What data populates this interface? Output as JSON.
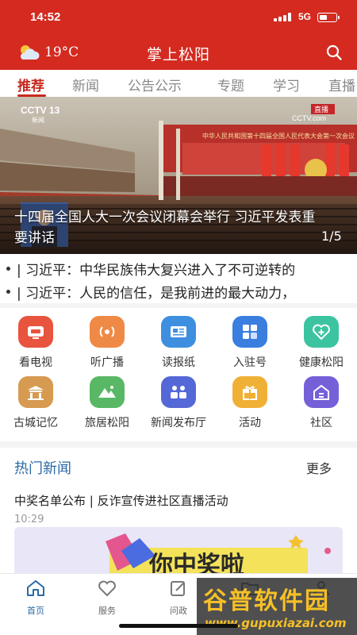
{
  "status": {
    "time": "14:52",
    "network": "5G"
  },
  "header": {
    "temperature": "19°C",
    "title": "掌上松阳",
    "weather_icon": "partly-cloudy-icon",
    "search_icon": "search-icon"
  },
  "tabs": [
    {
      "label": "推荐",
      "active": true
    },
    {
      "label": "新闻"
    },
    {
      "label": "公告公示"
    },
    {
      "label": "专题"
    },
    {
      "label": "学习"
    },
    {
      "label": "直播"
    }
  ],
  "banner": {
    "caption": "十四届全国人大一次会议闭幕会举行 习近平发表重要讲话",
    "counter": "1/5",
    "logo_text": "CCTV 13",
    "logo_sub": "新闻",
    "corner_badge": "直播",
    "corner_text": "CCTV.com",
    "stage_banner": "中华人民共和国第十四届全国人民代表大会第一次会议"
  },
  "ticker": [
    "| 习近平：中华民族伟大复兴进入了不可逆转的",
    "| 习近平：人民的信任，是我前进的最大动力，"
  ],
  "grid": [
    {
      "label": "看电视",
      "icon": "tv-icon",
      "color": "#e8543e"
    },
    {
      "label": "听广播",
      "icon": "radio-icon",
      "color": "#ef8a46"
    },
    {
      "label": "读报纸",
      "icon": "newspaper-icon",
      "color": "#3e8fe0"
    },
    {
      "label": "入驻号",
      "icon": "grid-apps-icon",
      "color": "#3a7ee0"
    },
    {
      "label": "健康松阳",
      "icon": "health-icon",
      "color": "#3cc4a0"
    },
    {
      "label": "古城记忆",
      "icon": "ancient-city-icon",
      "color": "#d69a50"
    },
    {
      "label": "旅居松阳",
      "icon": "travel-mountain-icon",
      "color": "#58b865"
    },
    {
      "label": "新闻发布厅",
      "icon": "press-room-icon",
      "color": "#5568d8"
    },
    {
      "label": "活动",
      "icon": "gift-icon",
      "color": "#f0b036"
    },
    {
      "label": "社区",
      "icon": "community-home-icon",
      "color": "#7560d8"
    }
  ],
  "hot_news": {
    "title": "热门新闻",
    "more": "更多",
    "item_title": "中奖名单公布 | 反诈宣传进社区直播活动",
    "item_time": "10:29",
    "promo_text": "你中奖啦"
  },
  "tabbar": [
    {
      "label": "首页",
      "icon": "home-icon",
      "active": true
    },
    {
      "label": "服务",
      "icon": "heart-icon"
    },
    {
      "label": "问政",
      "icon": "edit-icon"
    },
    {
      "label": "",
      "icon": "folder-icon"
    },
    {
      "label": "",
      "icon": "user-icon"
    }
  ],
  "watermark": {
    "brand": "谷普软件园",
    "url": "www.gupuxiazai.com"
  },
  "colors": {
    "header_red": "#d42a20",
    "accent_red": "#c8281e",
    "accent_blue": "#2b6aa6"
  }
}
